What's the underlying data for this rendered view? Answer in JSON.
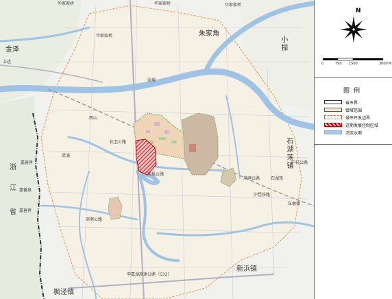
{
  "map": {
    "labels": {
      "n_town": "华家家桥",
      "n_town2": "华家家桥",
      "ne_town": "华家家桥",
      "town_ne": "华家家桥",
      "zhuzhuang": "朱家角",
      "xiaozheng": "小振",
      "jinze": "金泽",
      "shangda": "上达",
      "zhangyan": "张堰",
      "xishan": "西山",
      "liangpu": "梁浦",
      "province_zhejiang1": "浙",
      "province_zhejiang2": "江",
      "province_zhejiang3": "省",
      "shihu": "石湖荡镇",
      "xinbang": "新浜镇",
      "fengjing": "枫泾镇",
      "road_s": "朱枫公路",
      "road_s2": "泖港公路",
      "highway_s": "申嘉湖高速公路（S32）",
      "hwy_mid": "沪昆铁路",
      "town_w": "嘉善界",
      "town_w2": "嘉善界",
      "town_w3": "嘉善县",
      "town_e": "石湖荡",
      "mid_rd": "泖港公路",
      "mid_rd2": "松卫公路",
      "tr_rd": "沪杭公路",
      "tr_rd2": "车墩镇"
    }
  },
  "sidebar": {
    "north_label": "N",
    "scale_ticks": [
      "0",
      "750",
      "1500",
      "3000"
    ],
    "scale_unit": "M",
    "legend_title": "图例",
    "legend_items": [
      {
        "label": "省市界",
        "color": "#ffffff",
        "border": "#333333"
      },
      {
        "label": "镇域范围",
        "color": "#f3e6cf",
        "border": "#999999"
      },
      {
        "label": "城市开发边界",
        "color": "#ffffff",
        "border": "#d2691e"
      },
      {
        "label": "近期发展控制区域",
        "color": "#e8a0a0",
        "border": "#cc0000"
      },
      {
        "label": "河流水面",
        "color": "#a9c9e8",
        "border": "#8fb3d6"
      }
    ]
  }
}
